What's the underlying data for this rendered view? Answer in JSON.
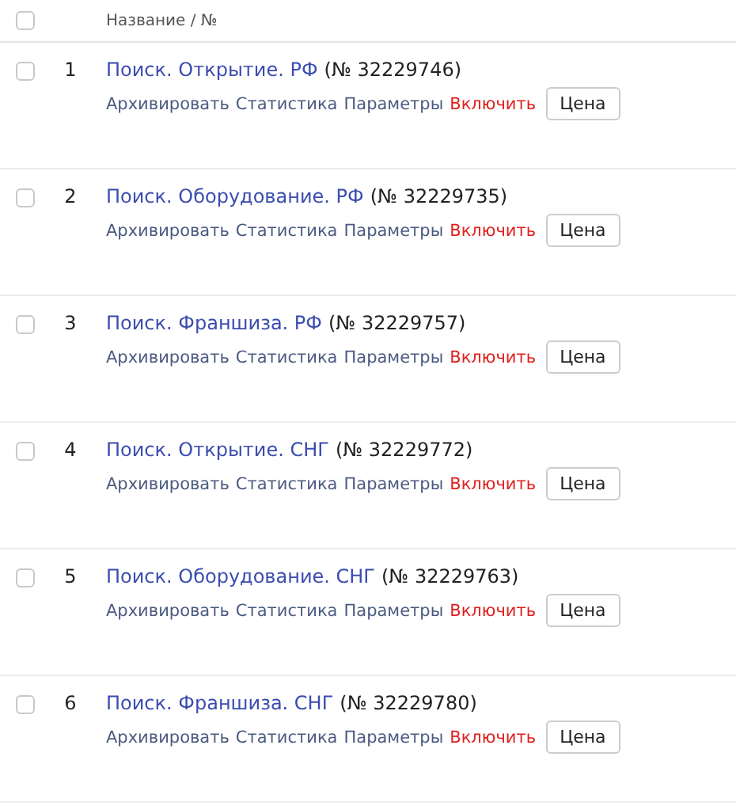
{
  "header": {
    "checked": false,
    "column_label": "Название / №"
  },
  "rows": [
    {
      "checked": false,
      "index": "1",
      "name": "Поиск. Открытие. РФ",
      "number": "(№ 32229746)",
      "actions": [
        {
          "kind": "link",
          "label": "Архивировать"
        },
        {
          "kind": "link",
          "label": "Статистика"
        },
        {
          "kind": "link",
          "label": "Параметры"
        },
        {
          "kind": "danger",
          "label": "Включить"
        },
        {
          "kind": "button",
          "label": "Цена"
        }
      ]
    },
    {
      "checked": false,
      "index": "2",
      "name": "Поиск. Оборудование. РФ",
      "number": "(№ 32229735)",
      "actions": [
        {
          "kind": "link",
          "label": "Архивировать"
        },
        {
          "kind": "link",
          "label": "Статистика"
        },
        {
          "kind": "link",
          "label": "Параметры"
        },
        {
          "kind": "danger",
          "label": "Включить"
        },
        {
          "kind": "button",
          "label": "Цена"
        }
      ]
    },
    {
      "checked": false,
      "index": "3",
      "name": "Поиск. Франшиза. РФ",
      "number": "(№ 32229757)",
      "actions": [
        {
          "kind": "link",
          "label": "Архивировать"
        },
        {
          "kind": "link",
          "label": "Статистика"
        },
        {
          "kind": "link",
          "label": "Параметры"
        },
        {
          "kind": "danger",
          "label": "Включить"
        },
        {
          "kind": "button",
          "label": "Цена"
        }
      ]
    },
    {
      "checked": false,
      "index": "4",
      "name": "Поиск. Открытие. СНГ",
      "number": "(№ 32229772)",
      "actions": [
        {
          "kind": "link",
          "label": "Архивировать"
        },
        {
          "kind": "link",
          "label": "Статистика"
        },
        {
          "kind": "link",
          "label": "Параметры"
        },
        {
          "kind": "danger",
          "label": "Включить"
        },
        {
          "kind": "button",
          "label": "Цена"
        }
      ]
    },
    {
      "checked": false,
      "index": "5",
      "name": "Поиск. Оборудование. СНГ",
      "number": "(№ 32229763)",
      "actions": [
        {
          "kind": "link",
          "label": "Архивировать"
        },
        {
          "kind": "link",
          "label": "Статистика"
        },
        {
          "kind": "link",
          "label": "Параметры"
        },
        {
          "kind": "danger",
          "label": "Включить"
        },
        {
          "kind": "button",
          "label": "Цена"
        }
      ]
    },
    {
      "checked": false,
      "index": "6",
      "name": "Поиск. Франшиза. СНГ",
      "number": "(№ 32229780)",
      "actions": [
        {
          "kind": "link",
          "label": "Архивировать"
        },
        {
          "kind": "link",
          "label": "Статистика"
        },
        {
          "kind": "link",
          "label": "Параметры"
        },
        {
          "kind": "danger",
          "label": "Включить"
        },
        {
          "kind": "button",
          "label": "Цена"
        }
      ]
    }
  ]
}
